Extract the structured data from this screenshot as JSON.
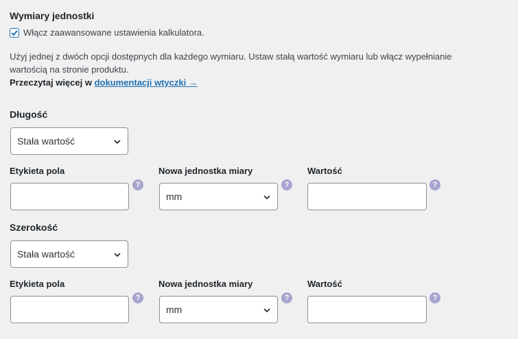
{
  "title": "Wymiary jednostki",
  "advanced": {
    "label": "Włącz zaawansowane ustawienia kalkulatora.",
    "checked": true
  },
  "description": "Użyj jednej z dwóch opcji dostępnych dla każdego wymiaru. Ustaw stałą wartość wymiaru lub włącz wypełnianie wartością na stronie produktu.",
  "read_more": {
    "prefix": "Przeczytaj więcej w",
    "link": "dokumentacji wtyczki →"
  },
  "sections": [
    {
      "title": "Długość",
      "mode": "Stała wartość",
      "field_label": "Etykieta pola",
      "unit_label": "Nowa jednostka miary",
      "unit_value": "mm",
      "value_label": "Wartość",
      "help": "?"
    },
    {
      "title": "Szerokość",
      "mode": "Stała wartość",
      "field_label": "Etykieta pola",
      "unit_label": "Nowa jednostka miary",
      "unit_value": "mm",
      "value_label": "Wartość",
      "help": "?"
    }
  ],
  "colors": {
    "accent": "#2271b1",
    "help": "#a7a4cf",
    "background": "#f0f0f1"
  }
}
